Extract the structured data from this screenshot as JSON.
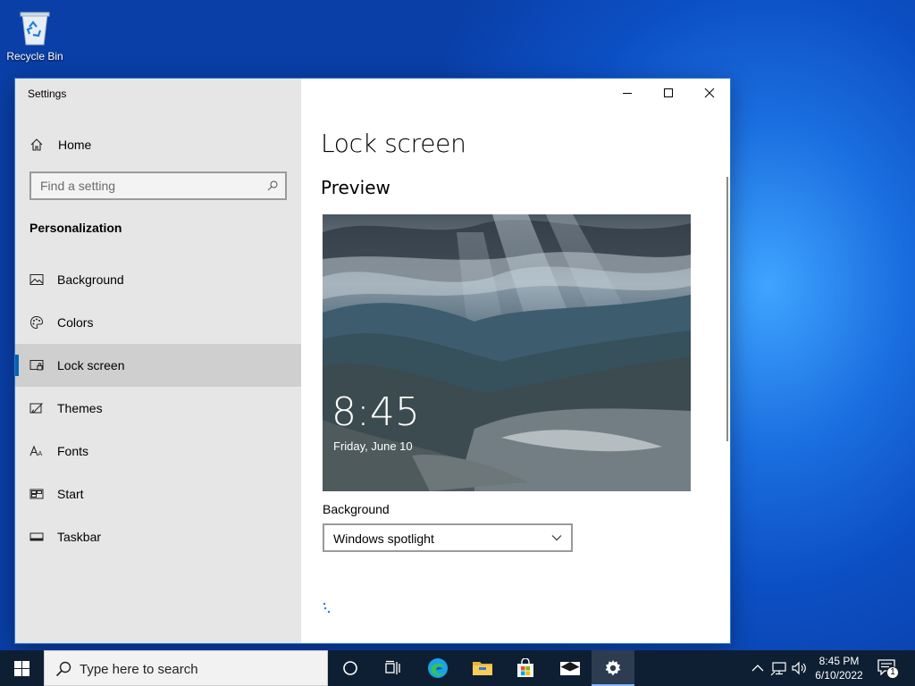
{
  "desktop": {
    "recycle_bin_label": "Recycle Bin"
  },
  "window": {
    "title": "Settings",
    "home_label": "Home",
    "search_placeholder": "Find a setting",
    "section_header": "Personalization",
    "nav_items": [
      {
        "label": "Background",
        "icon": "picture-icon",
        "selected": false
      },
      {
        "label": "Colors",
        "icon": "palette-icon",
        "selected": false
      },
      {
        "label": "Lock screen",
        "icon": "lock-screen-icon",
        "selected": true
      },
      {
        "label": "Themes",
        "icon": "brush-icon",
        "selected": false
      },
      {
        "label": "Fonts",
        "icon": "font-icon",
        "selected": false
      },
      {
        "label": "Start",
        "icon": "start-icon",
        "selected": false
      },
      {
        "label": "Taskbar",
        "icon": "taskbar-icon",
        "selected": false
      }
    ],
    "content": {
      "page_title": "Lock screen",
      "preview_heading": "Preview",
      "preview_time": "8:45",
      "preview_date": "Friday, June 10",
      "background_label": "Background",
      "background_value": "Windows spotlight"
    }
  },
  "taskbar": {
    "search_placeholder": "Type here to search",
    "clock_time": "8:45 PM",
    "clock_date": "6/10/2022",
    "notification_count": "1"
  },
  "colors": {
    "accent": "#0063b1",
    "sidebar_bg": "#e6e6e6",
    "selected_bg": "#cfcfcf",
    "taskbar_bg": "#0f1f33"
  }
}
